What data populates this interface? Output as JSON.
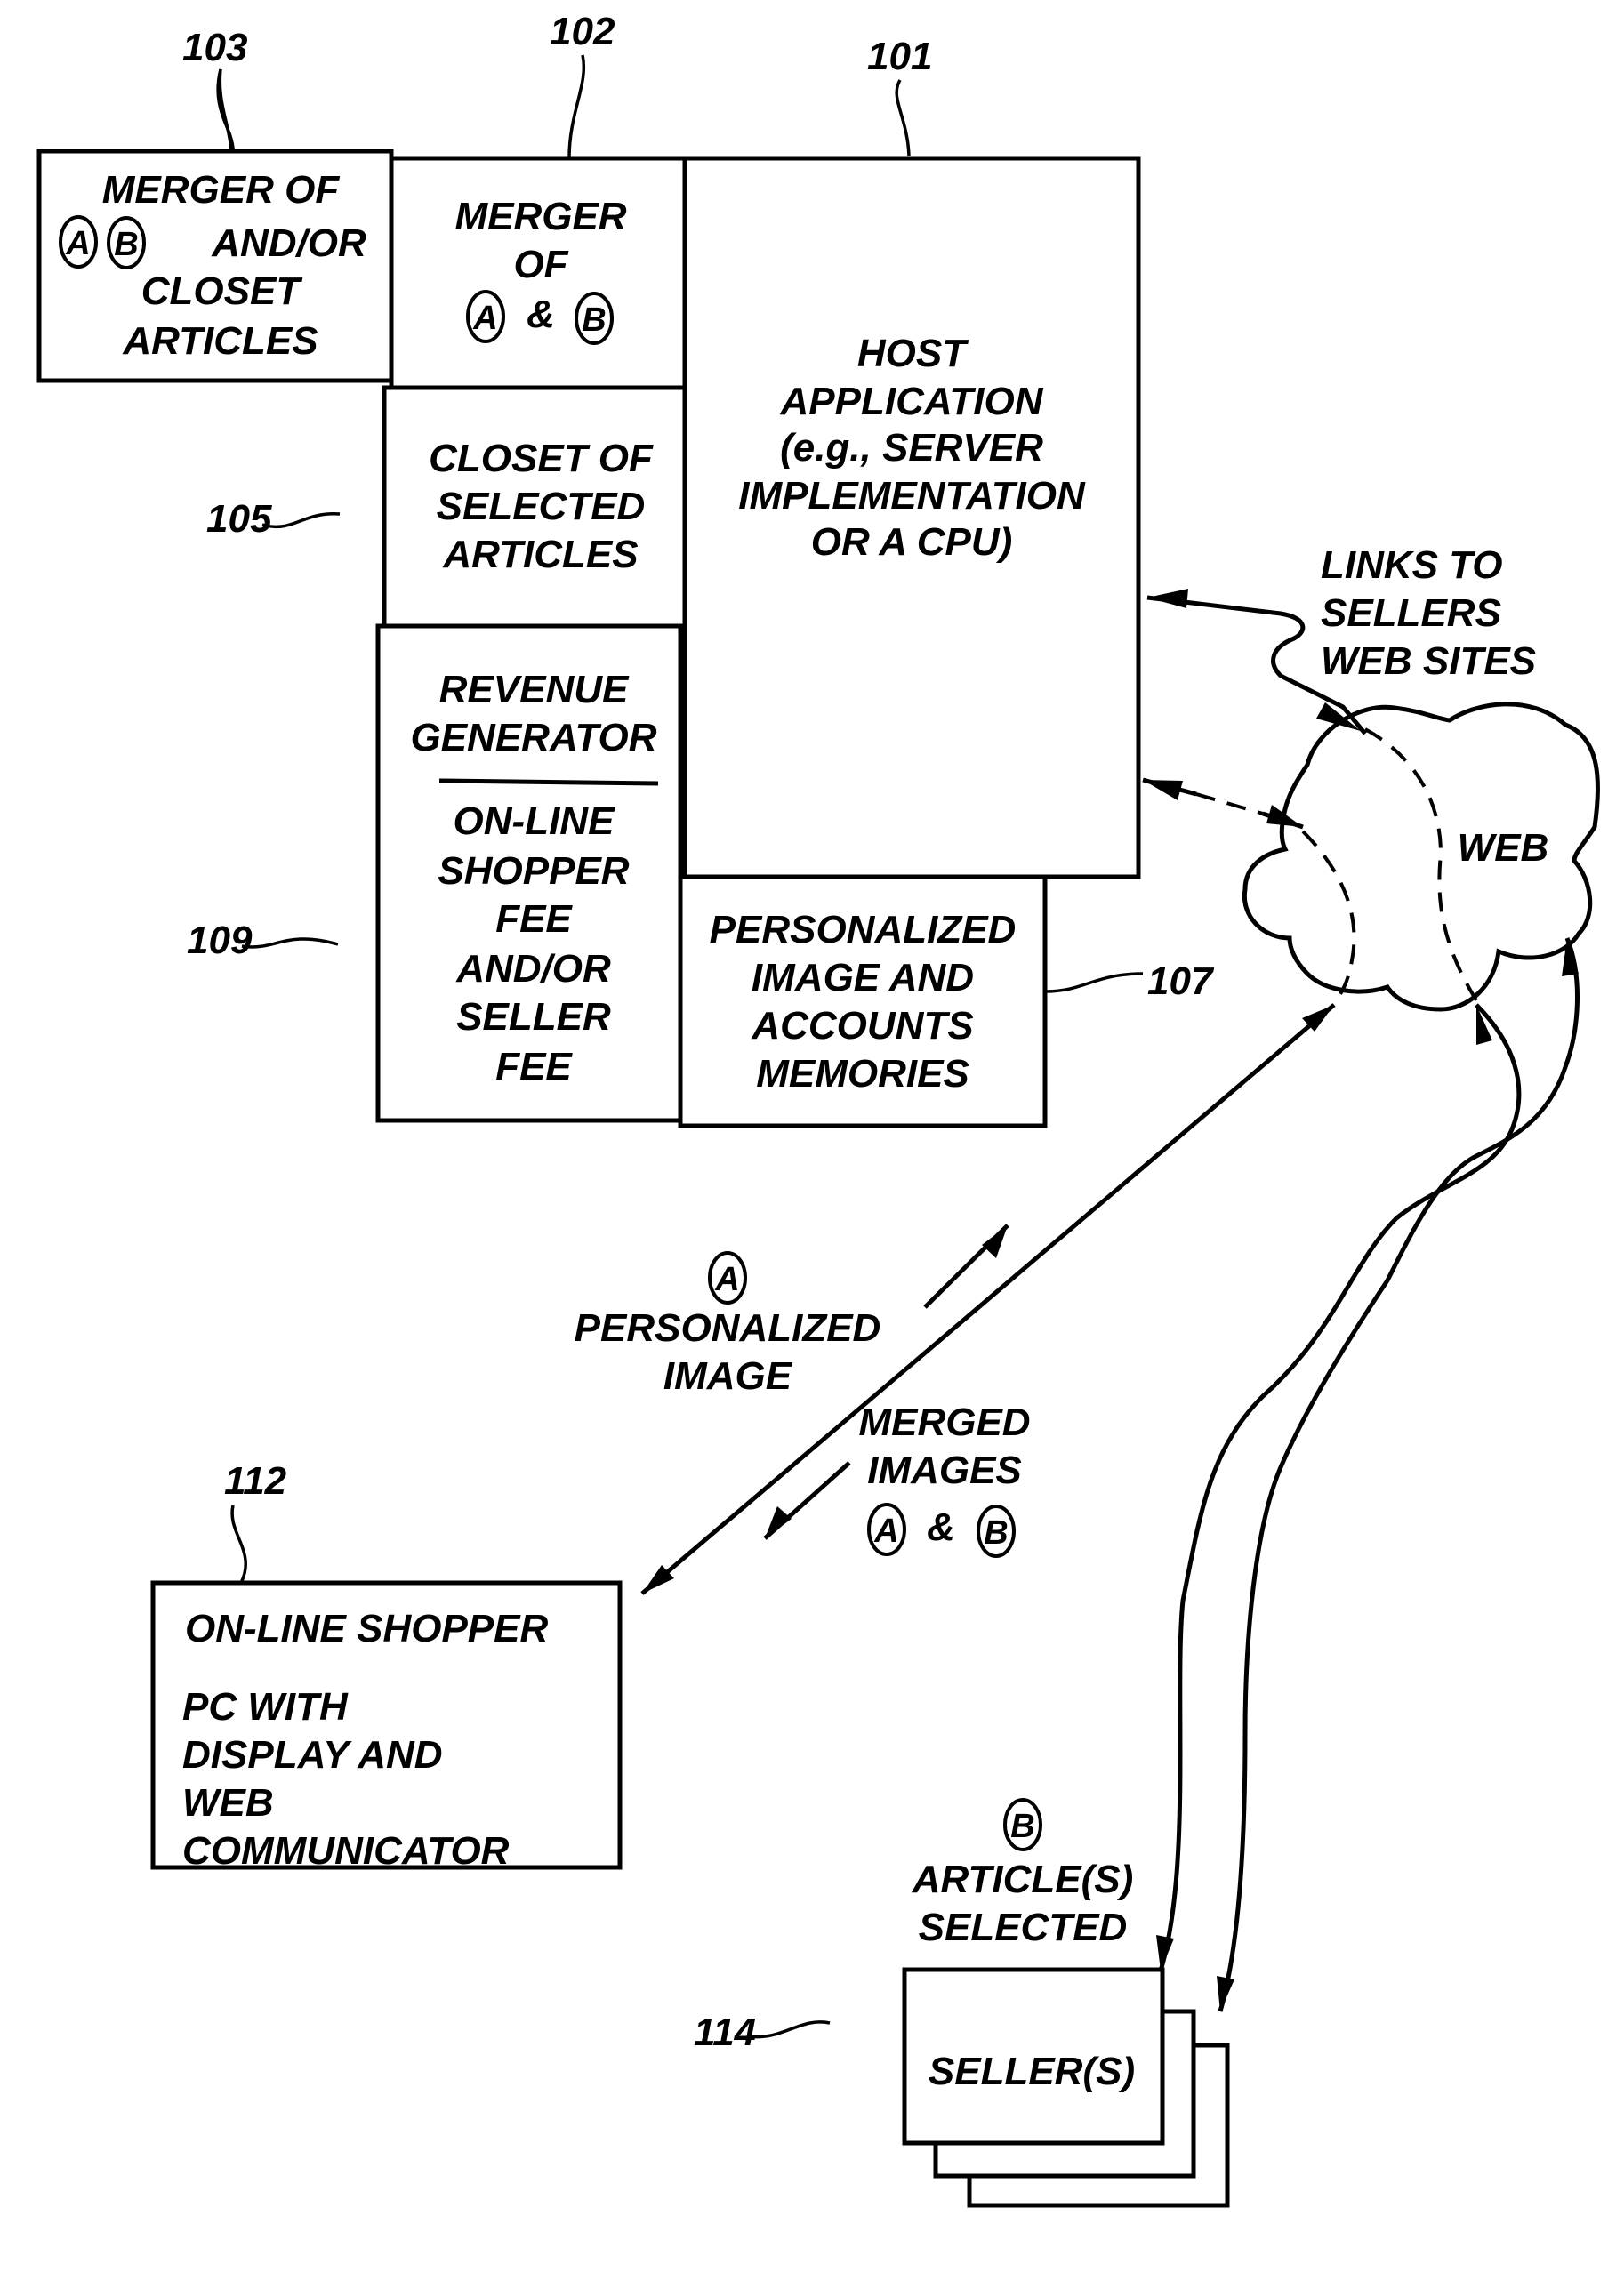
{
  "figure": {
    "type": "patent block diagram",
    "blocks": {
      "merger_ab_closet": {
        "ref": "103",
        "lines": [
          "MERGER OF",
          "AND/OR",
          "CLOSET",
          "ARTICLES"
        ],
        "markers": [
          "A",
          "B"
        ]
      },
      "merger_ab": {
        "ref": "102",
        "lines": [
          "MERGER",
          "OF",
          "&"
        ],
        "markers": [
          "A",
          "B"
        ]
      },
      "host_application": {
        "ref": "101",
        "lines": [
          "HOST",
          "APPLICATION",
          "(e.g., SERVER",
          "IMPLEMENTATION",
          "OR A CPU)"
        ]
      },
      "closet": {
        "ref": "105",
        "lines": [
          "CLOSET OF",
          "SELECTED",
          "ARTICLES"
        ]
      },
      "revenue_generator": {
        "ref": "109",
        "title_lines": [
          "REVENUE",
          "GENERATOR"
        ],
        "lines": [
          "ON-LINE",
          "SHOPPER",
          "FEE",
          "AND/OR",
          "SELLER",
          "FEE"
        ]
      },
      "memories": {
        "ref": "107",
        "lines": [
          "PERSONALIZED",
          "IMAGE AND",
          "ACCOUNTS",
          "MEMORIES"
        ]
      },
      "online_shopper": {
        "ref": "112",
        "title": "ON-LINE SHOPPER",
        "lines": [
          "PC WITH",
          "DISPLAY AND",
          "WEB",
          "COMMUNICATOR"
        ]
      },
      "sellers": {
        "ref": "114",
        "label": "SELLER(S)"
      },
      "web": {
        "label": "WEB"
      }
    },
    "annotations": {
      "links_to_sellers": [
        "LINKS TO",
        "SELLERS",
        "WEB SITES"
      ],
      "personalized_image": {
        "marker": "A",
        "lines": [
          "PERSONALIZED",
          "IMAGE"
        ]
      },
      "merged_images": {
        "lines": [
          "MERGED",
          "IMAGES",
          "&"
        ],
        "markers": [
          "A",
          "B"
        ]
      },
      "articles_selected": {
        "marker": "B",
        "lines": [
          "ARTICLE(S)",
          "SELECTED"
        ]
      }
    }
  }
}
